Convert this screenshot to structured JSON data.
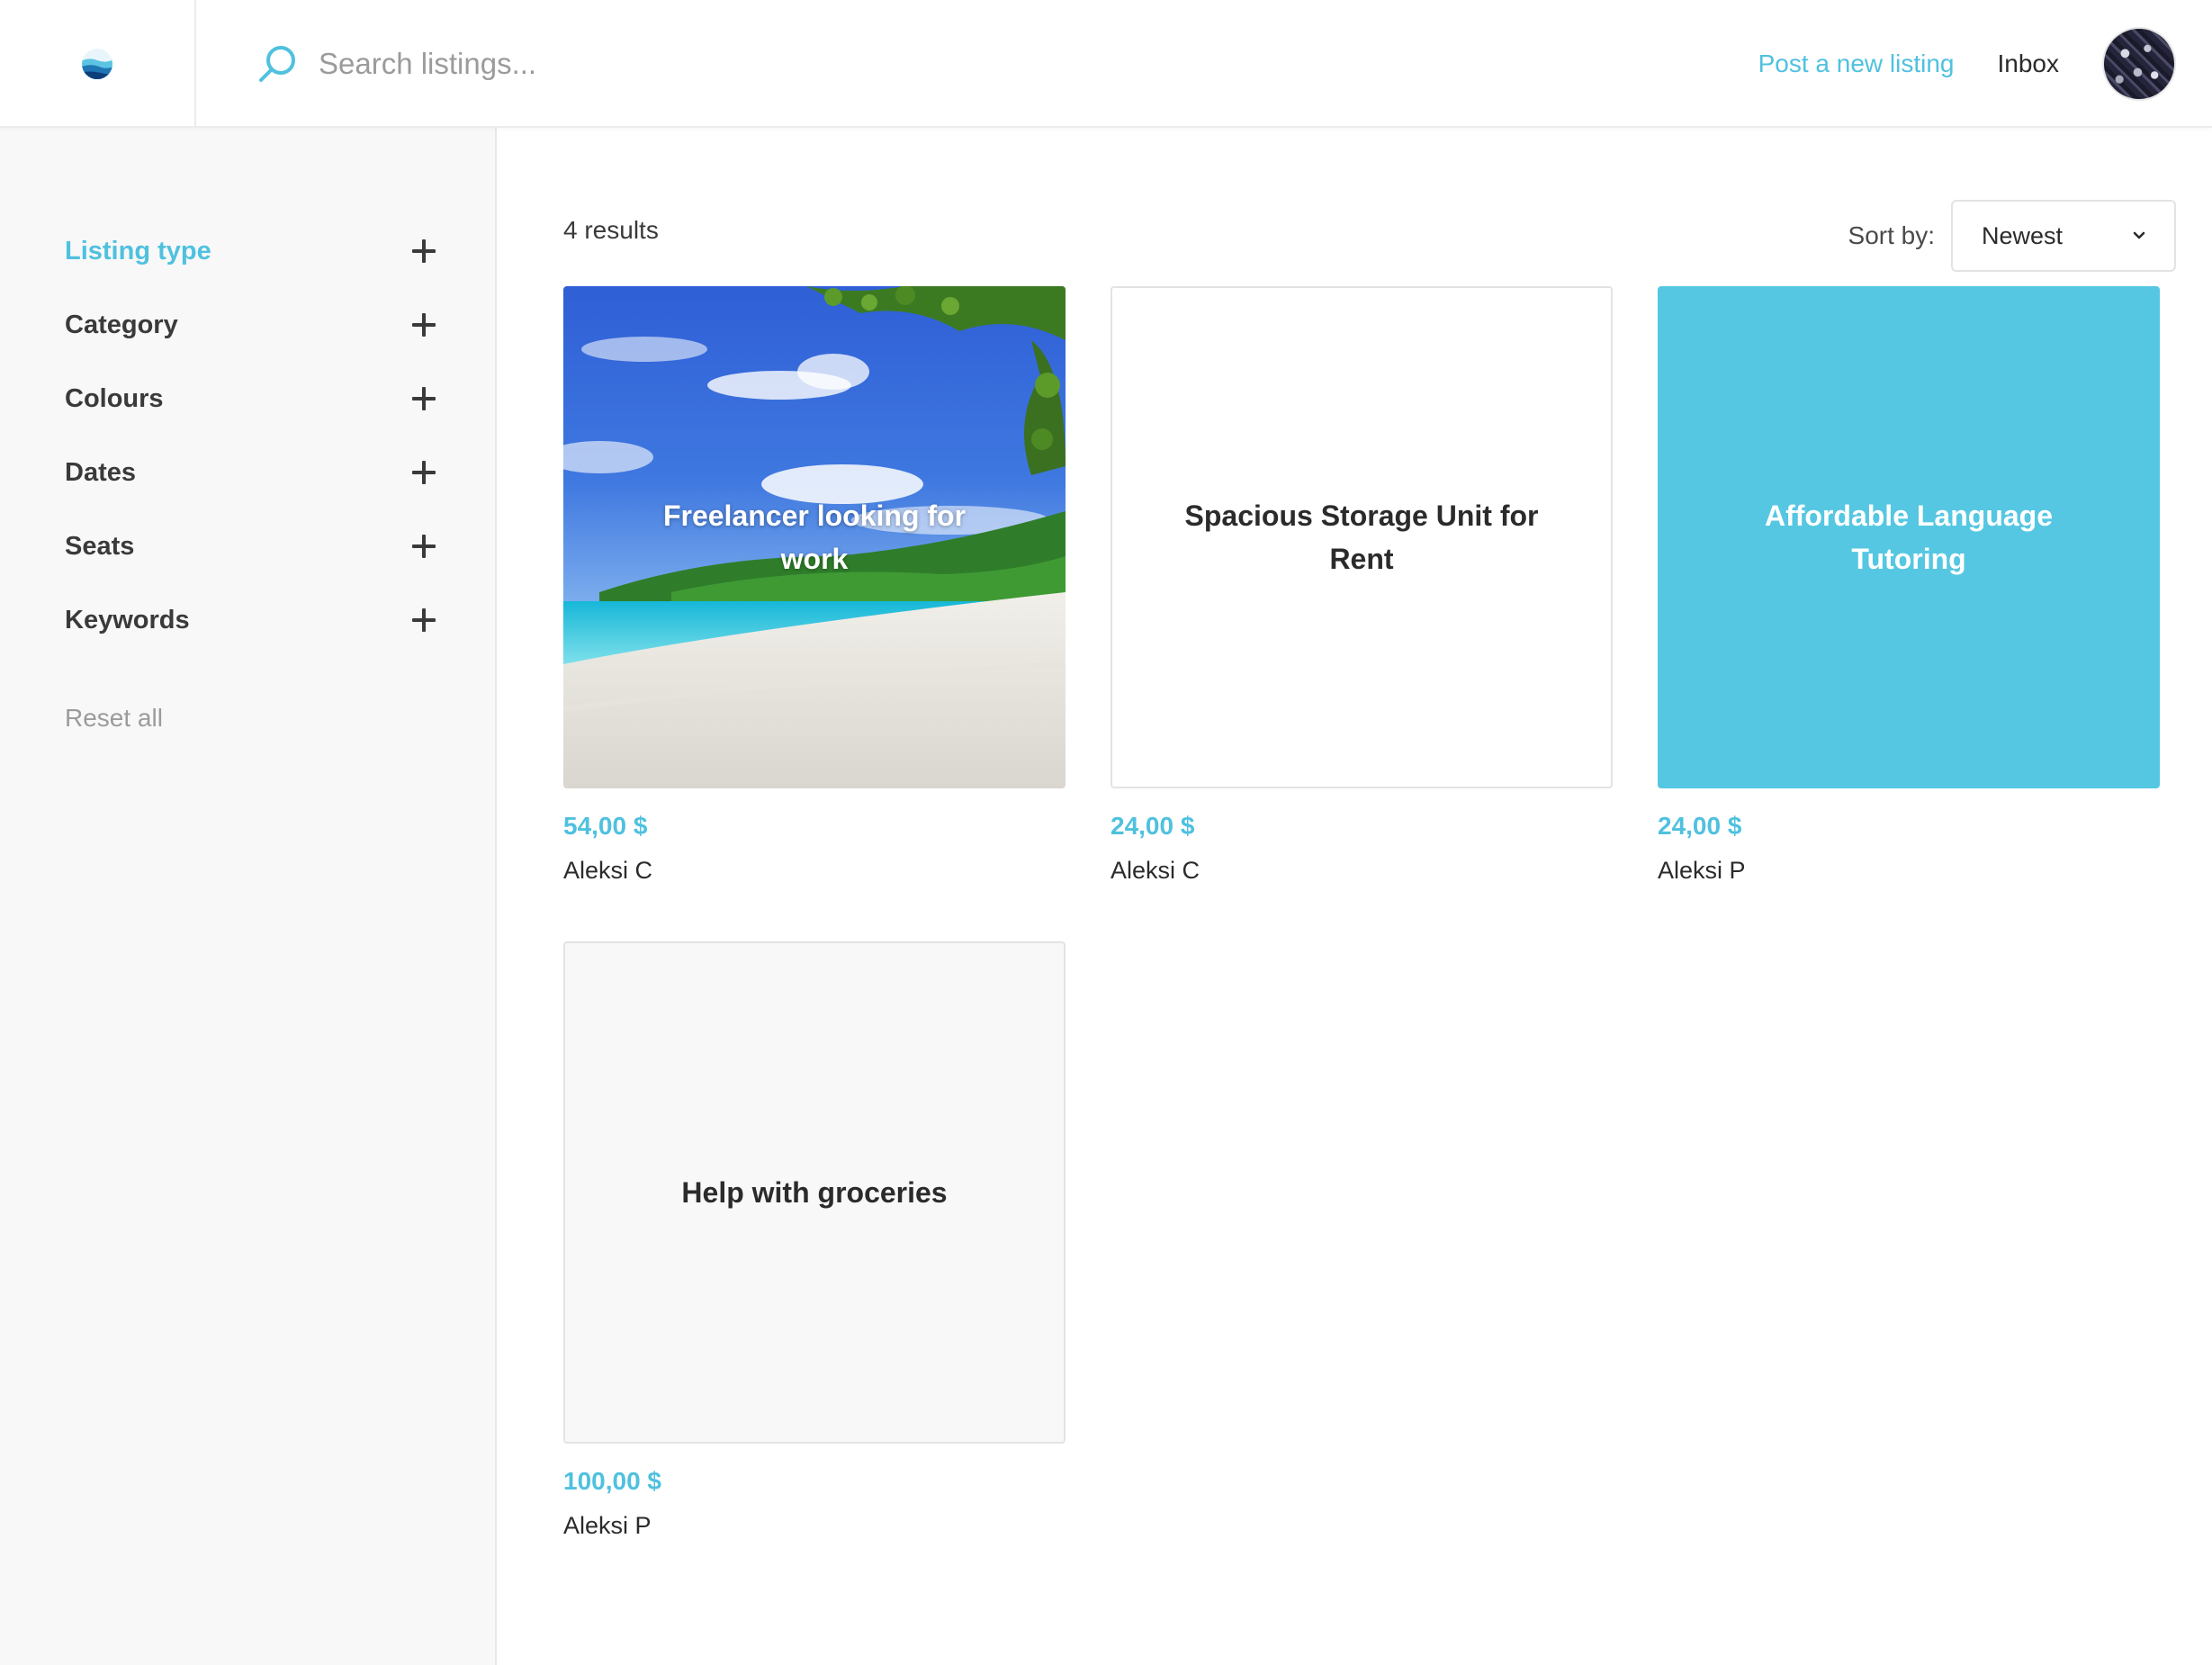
{
  "header": {
    "search_placeholder": "Search listings...",
    "post_listing_label": "Post a new listing",
    "inbox_label": "Inbox"
  },
  "sidebar": {
    "filters": [
      {
        "label": "Listing type",
        "active": true
      },
      {
        "label": "Category",
        "active": false
      },
      {
        "label": "Colours",
        "active": false
      },
      {
        "label": "Dates",
        "active": false
      },
      {
        "label": "Seats",
        "active": false
      },
      {
        "label": "Keywords",
        "active": false
      }
    ],
    "reset_label": "Reset all"
  },
  "main": {
    "results_count": "4 results",
    "sort_label": "Sort by:",
    "sort_value": "Newest",
    "listings": [
      {
        "title": "Freelancer looking for work",
        "price": "54,00 $",
        "author": "Aleksi C",
        "image": "beach-photo"
      },
      {
        "title": "Spacious Storage Unit for Rent",
        "price": "24,00 $",
        "author": "Aleksi C",
        "image": "white"
      },
      {
        "title": "Affordable Language Tutoring",
        "price": "24,00 $",
        "author": "Aleksi P",
        "image": "blue"
      },
      {
        "title": "Help with groceries",
        "price": "100,00 $",
        "author": "Aleksi P",
        "image": "grey"
      }
    ]
  },
  "colors": {
    "accent": "#4fc1df",
    "card_blue": "#55c7e2",
    "sidebar_bg": "#f8f8f8"
  },
  "icons": [
    "logo-icon",
    "search-icon",
    "plus-icon",
    "chevron-down-icon",
    "avatar"
  ]
}
